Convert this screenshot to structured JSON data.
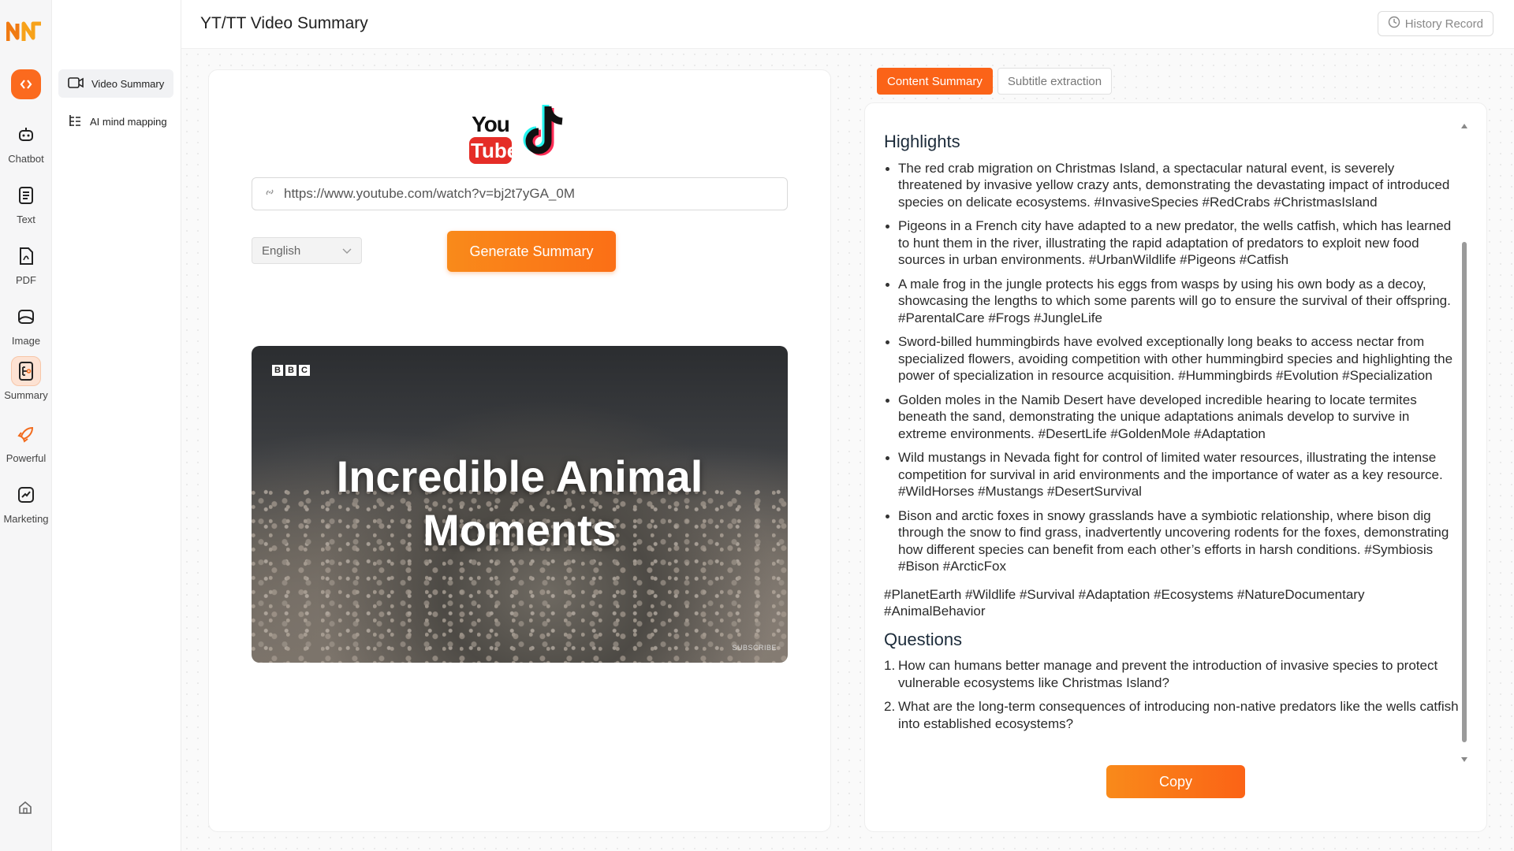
{
  "rail": {
    "items": [
      {
        "label": "Chatbot",
        "icon": "robot-icon"
      },
      {
        "label": "Text",
        "icon": "document-icon"
      },
      {
        "label": "PDF",
        "icon": "pdf-icon"
      },
      {
        "label": "Image",
        "icon": "image-icon"
      },
      {
        "label": "Summary",
        "icon": "summary-icon"
      },
      {
        "label": "Powerful",
        "icon": "rocket-icon"
      },
      {
        "label": "Marketing",
        "icon": "chart-icon"
      }
    ],
    "accent": "#fb6a1e"
  },
  "sidebar": {
    "items": [
      {
        "label": "Video Summary",
        "icon": "video-icon"
      },
      {
        "label": "AI mind mapping",
        "icon": "mind-map-icon"
      }
    ]
  },
  "header": {
    "title": "YT/TT Video Summary",
    "history_label": "History Record"
  },
  "input": {
    "brand_youtube_top": "You",
    "brand_youtube_bottom": "Tube",
    "url_value": "https://www.youtube.com/watch?v=bj2t7yGA_0M",
    "language": "English",
    "generate_label": "Generate Summary"
  },
  "video": {
    "channel_letters": [
      "B",
      "B",
      "C"
    ],
    "title": "Incredible Animal Moments",
    "subscribe": "SUBSCRIBE"
  },
  "tabs": {
    "content_summary": "Content Summary",
    "subtitle_extraction": "Subtitle extraction"
  },
  "summary": {
    "highlights_heading": "Highlights",
    "highlights": [
      "The red crab migration on Christmas Island, a spectacular natural event, is severely threatened by invasive yellow crazy ants, demonstrating the devastating impact of introduced species on delicate ecosystems. #InvasiveSpecies #RedCrabs #ChristmasIsland",
      "Pigeons in a French city have adapted to a new predator, the wells catfish, which has learned to hunt them in the river, illustrating the rapid adaptation of predators to exploit new food sources in urban environments. #UrbanWildlife #Pigeons #Catfish",
      "A male frog in the jungle protects his eggs from wasps by using his own body as a decoy, showcasing the lengths to which some parents will go to ensure the survival of their offspring. #ParentalCare #Frogs #JungleLife",
      "Sword-billed hummingbirds have evolved exceptionally long beaks to access nectar from specialized flowers, avoiding competition with other hummingbird species and highlighting the power of specialization in resource acquisition. #Hummingbirds #Evolution #Specialization",
      "Golden moles in the Namib Desert have developed incredible hearing to locate termites beneath the sand, demonstrating the unique adaptations animals develop to survive in extreme environments. #DesertLife #GoldenMole #Adaptation",
      "Wild mustangs in Nevada fight for control of limited water resources, illustrating the intense competition for survival in arid environments and the importance of water as a key resource. #WildHorses #Mustangs #DesertSurvival",
      "Bison and arctic foxes in snowy grasslands have a symbiotic relationship, where bison dig through the snow to find grass, inadvertently uncovering rodents for the foxes, demonstrating how different species can benefit from each other’s efforts in harsh conditions. #Symbiosis #Bison #ArcticFox"
    ],
    "tags": "#PlanetEarth #Wildlife #Survival #Adaptation #Ecosystems #NatureDocumentary #AnimalBehavior",
    "questions_heading": "Questions",
    "questions": [
      {
        "num": "1.",
        "text": "How can humans better manage and prevent the introduction of invasive species to protect vulnerable ecosystems like Christmas Island?"
      },
      {
        "num": "2.",
        "text": "What are the long-term consequences of introducing non-native predators like the wells catfish into established ecosystems?"
      }
    ],
    "copy_label": "Copy"
  }
}
